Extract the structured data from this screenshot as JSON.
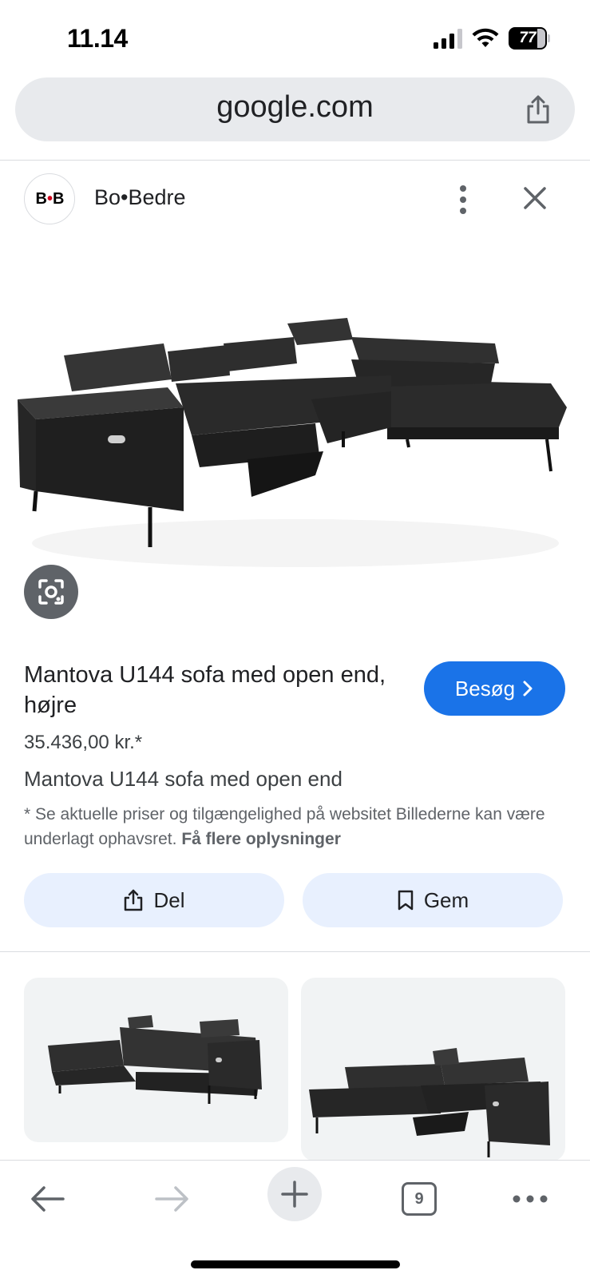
{
  "status_bar": {
    "time": "11.14",
    "battery": "77",
    "battery_level": 0.77
  },
  "browser": {
    "url": "google.com"
  },
  "site": {
    "logo_text_left": "B",
    "logo_text_right": "B",
    "name": "Bo•Bedre"
  },
  "product": {
    "title": "Mantova U144 sofa med open end, højre",
    "visit_label": "Besøg",
    "price": "35.436,00 kr.*",
    "subtitle": "Mantova U144 sofa med open end",
    "disclaimer": "* Se aktuelle priser og tilgængelighed på websitet Billederne kan være underlagt ophavsret.",
    "disclaimer_link": "Få flere oplysninger"
  },
  "actions": {
    "share_label": "Del",
    "save_label": "Gem"
  },
  "toolbar": {
    "tab_count": "9"
  },
  "icons": {
    "share": "share-icon",
    "more": "more-vert-icon",
    "close": "close-icon",
    "lens": "lens-icon",
    "chevron": "chevron-right-icon",
    "bookmark": "bookmark-icon",
    "back": "arrow-back-icon",
    "forward": "arrow-forward-icon",
    "new_tab": "plus-icon",
    "more_horiz": "more-horiz-icon"
  },
  "colors": {
    "accent": "#1a73e8",
    "chip_bg": "#e8f0fe",
    "url_bg": "#e8eaed"
  }
}
